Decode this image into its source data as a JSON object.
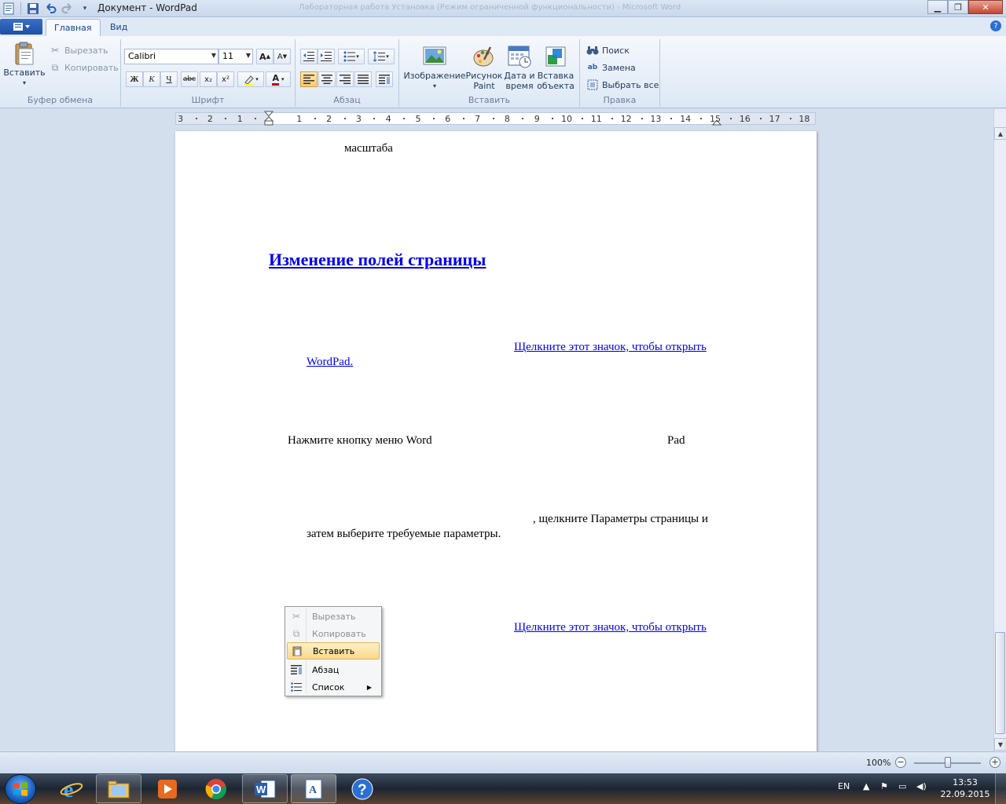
{
  "window": {
    "title": "Документ - WordPad",
    "ghost_title": "Лабораторная работа Установка (Режим ограниченной функциональности) - Microsoft Word"
  },
  "tabs": [
    {
      "label": "Главная",
      "active": true
    },
    {
      "label": "Вид",
      "active": false
    }
  ],
  "ribbon": {
    "clipboard": {
      "group_label": "Буфер обмена",
      "paste": "Вставить",
      "cut": "Вырезать",
      "copy": "Копировать"
    },
    "font": {
      "group_label": "Шрифт",
      "family": "Calibri",
      "size": "11",
      "grow": "A",
      "shrink": "A",
      "bold": "Ж",
      "italic": "К",
      "underline": "Ч",
      "strike": "abc",
      "subscript": "x₂",
      "superscript": "x²",
      "color_letter": "A"
    },
    "paragraph": {
      "group_label": "Абзац"
    },
    "insert": {
      "group_label": "Вставить",
      "image": "Изображение",
      "paint_line1": "Рисунок",
      "paint_line2": "Paint",
      "datetime_line1": "Дата и",
      "datetime_line2": "время",
      "object_line1": "Вставка",
      "object_line2": "объекта"
    },
    "editing": {
      "group_label": "Правка",
      "find": "Поиск",
      "replace": "Замена",
      "select_all": "Выбрать все"
    }
  },
  "ruler": {
    "labels": [
      "3",
      "2",
      "1",
      "1",
      "2",
      "3",
      "4",
      "5",
      "6",
      "7",
      "8",
      "9",
      "10",
      "11",
      "12",
      "13",
      "14",
      "15",
      "16",
      "17",
      "18"
    ]
  },
  "document": {
    "line_scale": "масштаба",
    "heading": "Изменение полей страницы",
    "link1_part1": "Щелкните этот значок, чтобы открыть",
    "link1_part2": "WordPad.",
    "text_menu_left": "Нажмите кнопку меню Word",
    "text_menu_right": "Pad",
    "text_params_line1": ", щелкните Параметры страницы и",
    "text_params_line2": "затем выберите требуемые параметры.",
    "link2": "Щелкните этот значок, чтобы открыть"
  },
  "context_menu": {
    "items": [
      {
        "label": "Вырезать",
        "enabled": false,
        "highlighted": false,
        "icon": "scissors-icon"
      },
      {
        "label": "Копировать",
        "enabled": false,
        "highlighted": false,
        "icon": "copy-icon"
      },
      {
        "label": "Вставить",
        "enabled": true,
        "highlighted": true,
        "icon": "paste-icon"
      },
      {
        "label": "Абзац",
        "enabled": true,
        "highlighted": false,
        "icon": "paragraph-icon"
      },
      {
        "label": "Список",
        "enabled": true,
        "highlighted": false,
        "icon": "list-icon",
        "submenu": true
      }
    ]
  },
  "statusbar": {
    "zoom": "100%",
    "zoom_level": 1.0
  },
  "taskbar": {
    "lang": "EN",
    "time": "13:53",
    "date": "22.09.2015"
  },
  "colors": {
    "link": "#0000ee",
    "ribbon_bg": "#dde8f5",
    "highlight": "#f9d98a"
  }
}
